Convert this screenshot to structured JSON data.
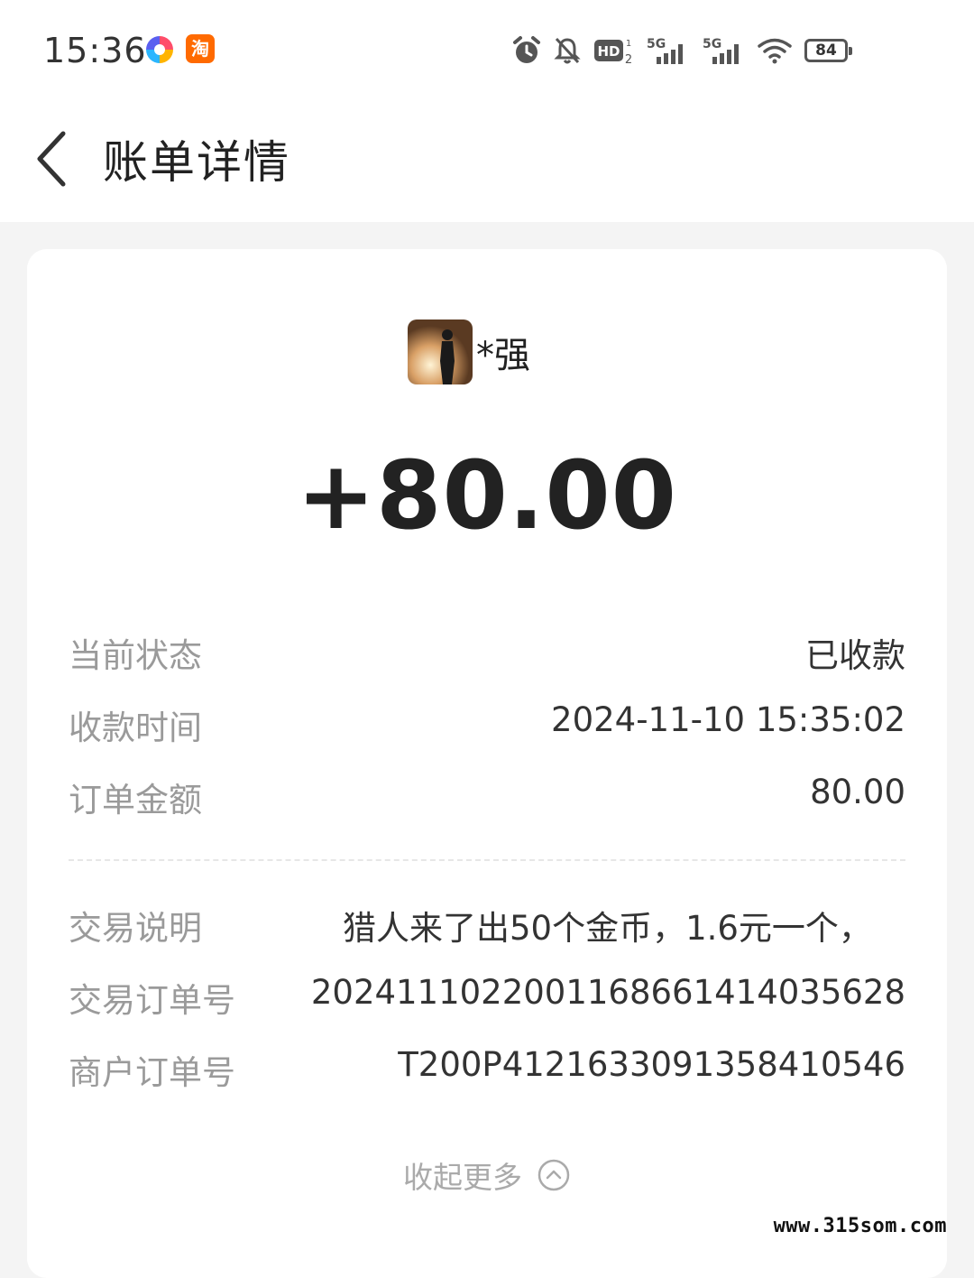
{
  "status_bar": {
    "time": "15:36",
    "app_icon_b_label": "淘",
    "battery_level": "84"
  },
  "header": {
    "title": "账单详情"
  },
  "payer": {
    "name": "*强"
  },
  "amount": "+80.00",
  "details": [
    {
      "label": "当前状态",
      "value": "已收款"
    },
    {
      "label": "收款时间",
      "value": "2024-11-10 15:35:02"
    },
    {
      "label": "订单金额",
      "value": "80.00"
    },
    {
      "label": "交易说明",
      "value": "猎人来了出50个金币，1.6元一个，"
    },
    {
      "label": "交易订单号",
      "value": "2024111022001168661414035628"
    },
    {
      "label": "商户订单号",
      "value": "T200P4121633091358410546"
    }
  ],
  "collapse_label": "收起更多",
  "watermark": "www.315som.com"
}
